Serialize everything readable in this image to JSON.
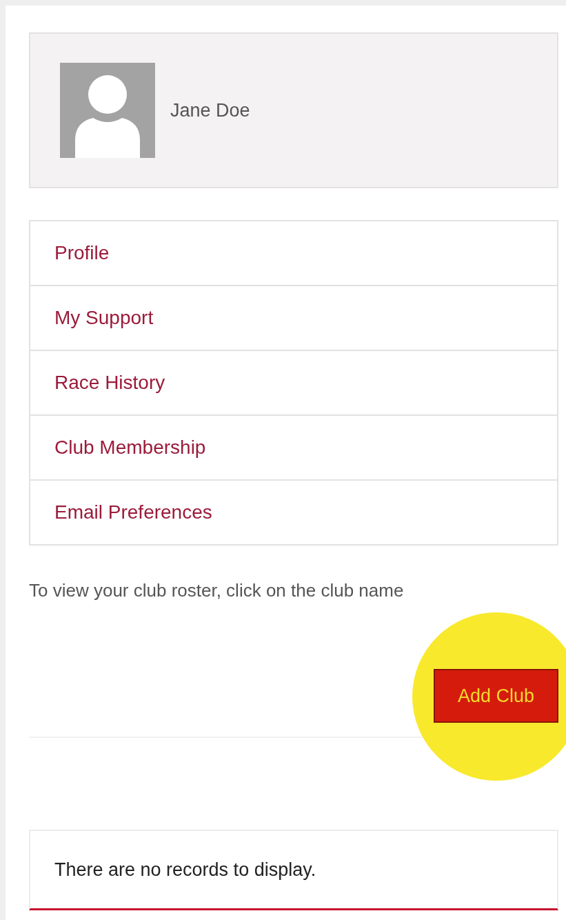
{
  "profile": {
    "name": "Jane Doe"
  },
  "menu": [
    {
      "label": "Profile"
    },
    {
      "label": "My Support"
    },
    {
      "label": "Race History"
    },
    {
      "label": "Club Membership"
    },
    {
      "label": "Email Preferences"
    }
  ],
  "note": "To view your club roster, click on the club name",
  "add_button": {
    "label": "Add Club"
  },
  "records": {
    "empty_message": "There are no records to display."
  }
}
